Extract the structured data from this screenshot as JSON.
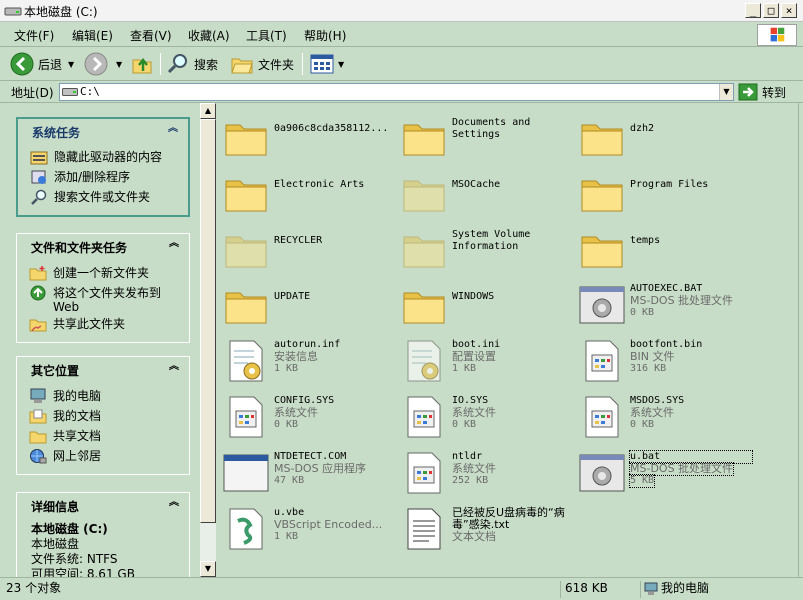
{
  "window": {
    "title": "本地磁盘 (C:)",
    "controls": {
      "minimize": "_",
      "maximize": "□",
      "close": "×"
    }
  },
  "menu": [
    "文件(F)",
    "编辑(E)",
    "查看(V)",
    "收藏(A)",
    "工具(T)",
    "帮助(H)"
  ],
  "toolbar": {
    "back": "后退",
    "search": "搜索",
    "folders": "文件夹"
  },
  "address": {
    "label": "地址(D)",
    "value": "C:\\",
    "go": "转到"
  },
  "sidebar": {
    "system_tasks": {
      "title": "系统任务",
      "items": [
        "隐藏此驱动器的内容",
        "添加/删除程序",
        "搜索文件或文件夹"
      ]
    },
    "file_tasks": {
      "title": "文件和文件夹任务",
      "items": [
        "创建一个新文件夹",
        "将这个文件夹发布到 Web",
        "共享此文件夹"
      ]
    },
    "other_places": {
      "title": "其它位置",
      "items": [
        "我的电脑",
        "我的文档",
        "共享文档",
        "网上邻居"
      ]
    },
    "details": {
      "title": "详细信息",
      "name": "本地磁盘 (C:)",
      "type": "本地磁盘",
      "fs": "文件系统: NTFS",
      "free": "可用空间: 8.61 GB"
    }
  },
  "files": [
    {
      "name": "0a906c8cda358112...",
      "type": "",
      "size": "",
      "icon": "folder",
      "faded": false
    },
    {
      "name": "Documents and Settings",
      "type": "",
      "size": "",
      "icon": "folder",
      "faded": false
    },
    {
      "name": "dzh2",
      "type": "",
      "size": "",
      "icon": "folder",
      "faded": false
    },
    {
      "name": "Electronic Arts",
      "type": "",
      "size": "",
      "icon": "folder",
      "faded": false
    },
    {
      "name": "MSOCache",
      "type": "",
      "size": "",
      "icon": "folder",
      "faded": true
    },
    {
      "name": "Program Files",
      "type": "",
      "size": "",
      "icon": "folder",
      "faded": false
    },
    {
      "name": "RECYCLER",
      "type": "",
      "size": "",
      "icon": "folder",
      "faded": true
    },
    {
      "name": "System Volume Information",
      "type": "",
      "size": "",
      "icon": "folder",
      "faded": true
    },
    {
      "name": "temps",
      "type": "",
      "size": "",
      "icon": "folder",
      "faded": false
    },
    {
      "name": "UPDATE",
      "type": "",
      "size": "",
      "icon": "folder",
      "faded": false
    },
    {
      "name": "WINDOWS",
      "type": "",
      "size": "",
      "icon": "folder",
      "faded": false
    },
    {
      "name": "AUTOEXEC.BAT",
      "type": "MS-DOS 批处理文件",
      "size": "0 KB",
      "icon": "batch",
      "faded": false
    },
    {
      "name": "autorun.inf",
      "type": "安装信息",
      "size": "1 KB",
      "icon": "inf",
      "faded": false
    },
    {
      "name": "boot.ini",
      "type": "配置设置",
      "size": "1 KB",
      "icon": "inf",
      "faded": true
    },
    {
      "name": "bootfont.bin",
      "type": "BIN 文件",
      "size": "316 KB",
      "icon": "sysfile",
      "faded": false
    },
    {
      "name": "CONFIG.SYS",
      "type": "系统文件",
      "size": "0 KB",
      "icon": "sysfile",
      "faded": false
    },
    {
      "name": "IO.SYS",
      "type": "系统文件",
      "size": "0 KB",
      "icon": "sysfile",
      "faded": false
    },
    {
      "name": "MSDOS.SYS",
      "type": "系统文件",
      "size": "0 KB",
      "icon": "sysfile",
      "faded": false
    },
    {
      "name": "NTDETECT.COM",
      "type": "MS-DOS 应用程序",
      "size": "47 KB",
      "icon": "app",
      "faded": false
    },
    {
      "name": "ntldr",
      "type": "系统文件",
      "size": "252 KB",
      "icon": "sysfile",
      "faded": false
    },
    {
      "name": "u.bat",
      "type": "MS-DOS 批处理文件",
      "size": "5 KB",
      "icon": "batch",
      "faded": false,
      "selected": true
    },
    {
      "name": "u.vbe",
      "type": "VBScript Encoded...",
      "size": "1 KB",
      "icon": "vbe",
      "faded": false
    },
    {
      "name": "已经被反U盘病毒的“病毒”感染.txt",
      "type": "文本文档",
      "size": "",
      "icon": "txt",
      "faded": false
    }
  ],
  "status": {
    "count": "23 个对象",
    "size": "618 KB",
    "location": "我的电脑"
  }
}
